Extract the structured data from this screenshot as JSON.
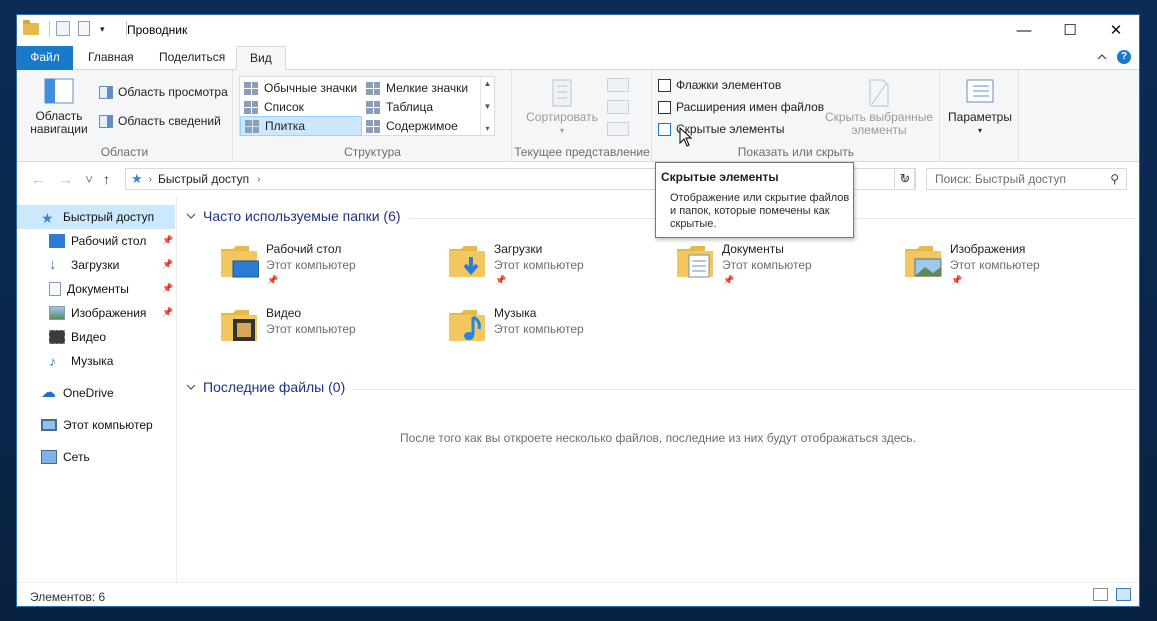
{
  "window": {
    "title": "Проводник",
    "caption": {
      "minimize": "—",
      "maximize": "☐",
      "close": "✕"
    }
  },
  "tabs": [
    {
      "label": "Файл"
    },
    {
      "label": "Главная"
    },
    {
      "label": "Поделиться"
    },
    {
      "label": "Вид"
    }
  ],
  "ribbon": {
    "areas": {
      "label": "Области",
      "nav_pane": "Область навигации",
      "preview": "Область просмотра",
      "details": "Область сведений"
    },
    "layout": {
      "label": "Структура",
      "items": [
        "Обычные значки",
        "Мелкие значки",
        "Список",
        "Таблица",
        "Плитка",
        "Содержимое"
      ],
      "selected": "Плитка"
    },
    "current_view": {
      "label": "Текущее представление",
      "sort": "Сортировать"
    },
    "show_hide": {
      "label": "Показать или скрыть",
      "checkboxes": [
        "Флажки элементов",
        "Расширения имен файлов",
        "Скрытые элементы"
      ],
      "hide_selected": "Скрыть выбранные элементы"
    },
    "options": "Параметры"
  },
  "tooltip": {
    "title": "Скрытые элементы",
    "body": "Отображение или скрытие файлов и папок, которые помечены как скрытые."
  },
  "address": {
    "path": "Быстрый доступ",
    "search_placeholder": "Поиск: Быстрый доступ"
  },
  "nav": {
    "items": [
      {
        "label": "Быстрый доступ",
        "icon": "star-icon"
      },
      {
        "label": "Рабочий стол",
        "icon": "desktop-icon"
      },
      {
        "label": "Загрузки",
        "icon": "download-icon"
      },
      {
        "label": "Документы",
        "icon": "documents-icon"
      },
      {
        "label": "Изображения",
        "icon": "pictures-icon"
      },
      {
        "label": "Видео",
        "icon": "video-icon"
      },
      {
        "label": "Музыка",
        "icon": "music-icon"
      },
      {
        "label": "OneDrive",
        "icon": "onedrive-icon"
      },
      {
        "label": "Этот компьютер",
        "icon": "computer-icon"
      },
      {
        "label": "Сеть",
        "icon": "network-icon"
      }
    ]
  },
  "content": {
    "frequent_header": "Часто используемые папки (6)",
    "folders": [
      {
        "name": "Рабочий стол",
        "loc": "Этот компьютер"
      },
      {
        "name": "Загрузки",
        "loc": "Этот компьютер"
      },
      {
        "name": "Документы",
        "loc": "Этот компьютер"
      },
      {
        "name": "Изображения",
        "loc": "Этот компьютер"
      },
      {
        "name": "Видео",
        "loc": "Этот компьютер"
      },
      {
        "name": "Музыка",
        "loc": "Этот компьютер"
      }
    ],
    "recent_header": "Последние файлы (0)",
    "recent_empty": "После того как вы откроете несколько файлов, последние из них будут отображаться здесь."
  },
  "status": {
    "count": "Элементов: 6"
  },
  "colors": {
    "accent": "#1979ca",
    "selection": "#cce8ff",
    "header_text": "#1e3287",
    "folder": "#e8b84a"
  }
}
